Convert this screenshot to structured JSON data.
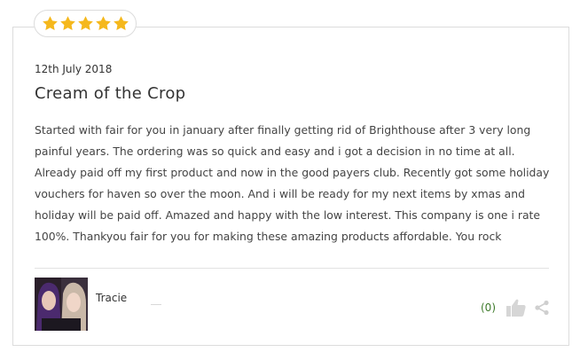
{
  "review": {
    "rating": 5,
    "rating_max": 5,
    "star_color": "#f5b81c",
    "date": "12th July 2018",
    "title": "Cream of the Crop",
    "body": "Started with fair for you in january after finally getting rid of Brighthouse after 3 very long painful years. The ordering was so quick and easy and i got a decision in no time at all. Already paid off my first product and now in the good payers club. Recently got some holiday vouchers for haven so over the moon. And i will be ready for my next items by xmas and holiday will be paid off. Amazed and happy with the low interest. This company is one i rate 100%. Thankyou fair for you for making these amazing products affordable. You rock",
    "author": "Tracie",
    "helpful_count": "(0)",
    "helpful_color": "#3d7a2a"
  },
  "icons": {
    "star": "star-icon",
    "thumb": "thumbs-up-icon",
    "share": "share-icon"
  }
}
